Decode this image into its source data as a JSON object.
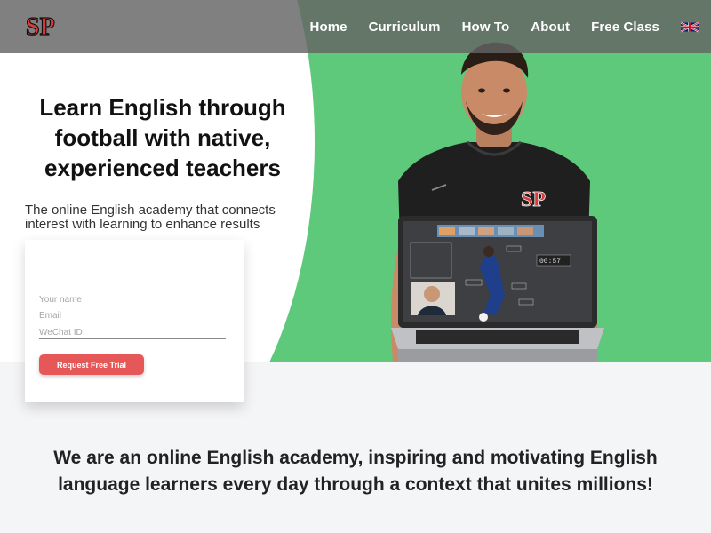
{
  "brand": {
    "logo_text": "SP"
  },
  "nav": {
    "items": [
      "Home",
      "Curriculum",
      "How To",
      "About",
      "Free Class"
    ],
    "language_flag": "uk-flag-icon"
  },
  "hero": {
    "headline": "Learn English through football with native, experienced teachers",
    "subtitle": "The online English academy that connects interest with learning to enhance results",
    "bg_color": "#5fc97b",
    "logo_color": "#e24b4b"
  },
  "form": {
    "name_placeholder": "Your name",
    "email_placeholder": "Email",
    "wechat_placeholder": "WeChat ID",
    "submit_label": "Request Free Trial",
    "button_color": "#e65858"
  },
  "laptop_screen": {
    "timer": "00:57"
  },
  "mission": {
    "text": "We are an online English academy, inspiring and motivating English language learners every day through a context that unites millions!"
  }
}
